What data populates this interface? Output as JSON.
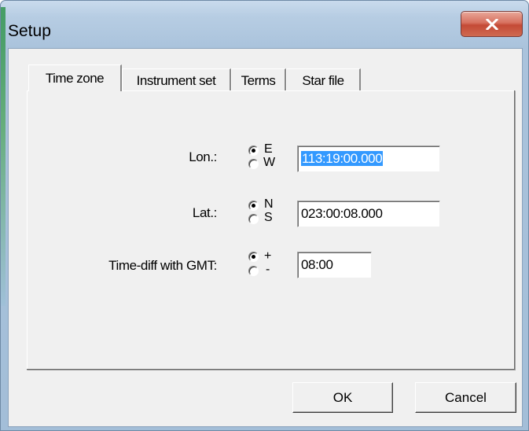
{
  "window": {
    "title": "Setup",
    "close_icon": "close-icon"
  },
  "tabs": [
    {
      "label": "Time zone",
      "selected": true
    },
    {
      "label": "Instrument set",
      "selected": false
    },
    {
      "label": "Terms",
      "selected": false
    },
    {
      "label": "Star file",
      "selected": false
    }
  ],
  "fields": {
    "lon": {
      "label": "Lon.:",
      "options": [
        {
          "label": "E",
          "checked": true
        },
        {
          "label": "W",
          "checked": false
        }
      ],
      "value": "113:19:00.000",
      "value_selected": true
    },
    "lat": {
      "label": "Lat.:",
      "options": [
        {
          "label": "N",
          "checked": true
        },
        {
          "label": "S",
          "checked": false
        }
      ],
      "value": "023:00:08.000"
    },
    "gmt": {
      "label": "Time-diff with GMT:",
      "options": [
        {
          "label": "+",
          "checked": true
        },
        {
          "label": "-",
          "checked": false
        }
      ],
      "value": "08:00"
    }
  },
  "buttons": {
    "ok": "OK",
    "cancel": "Cancel"
  },
  "colors": {
    "selection": "#3399ff",
    "close_button": "#c44a36",
    "dialog_face": "#f0f0f0"
  }
}
